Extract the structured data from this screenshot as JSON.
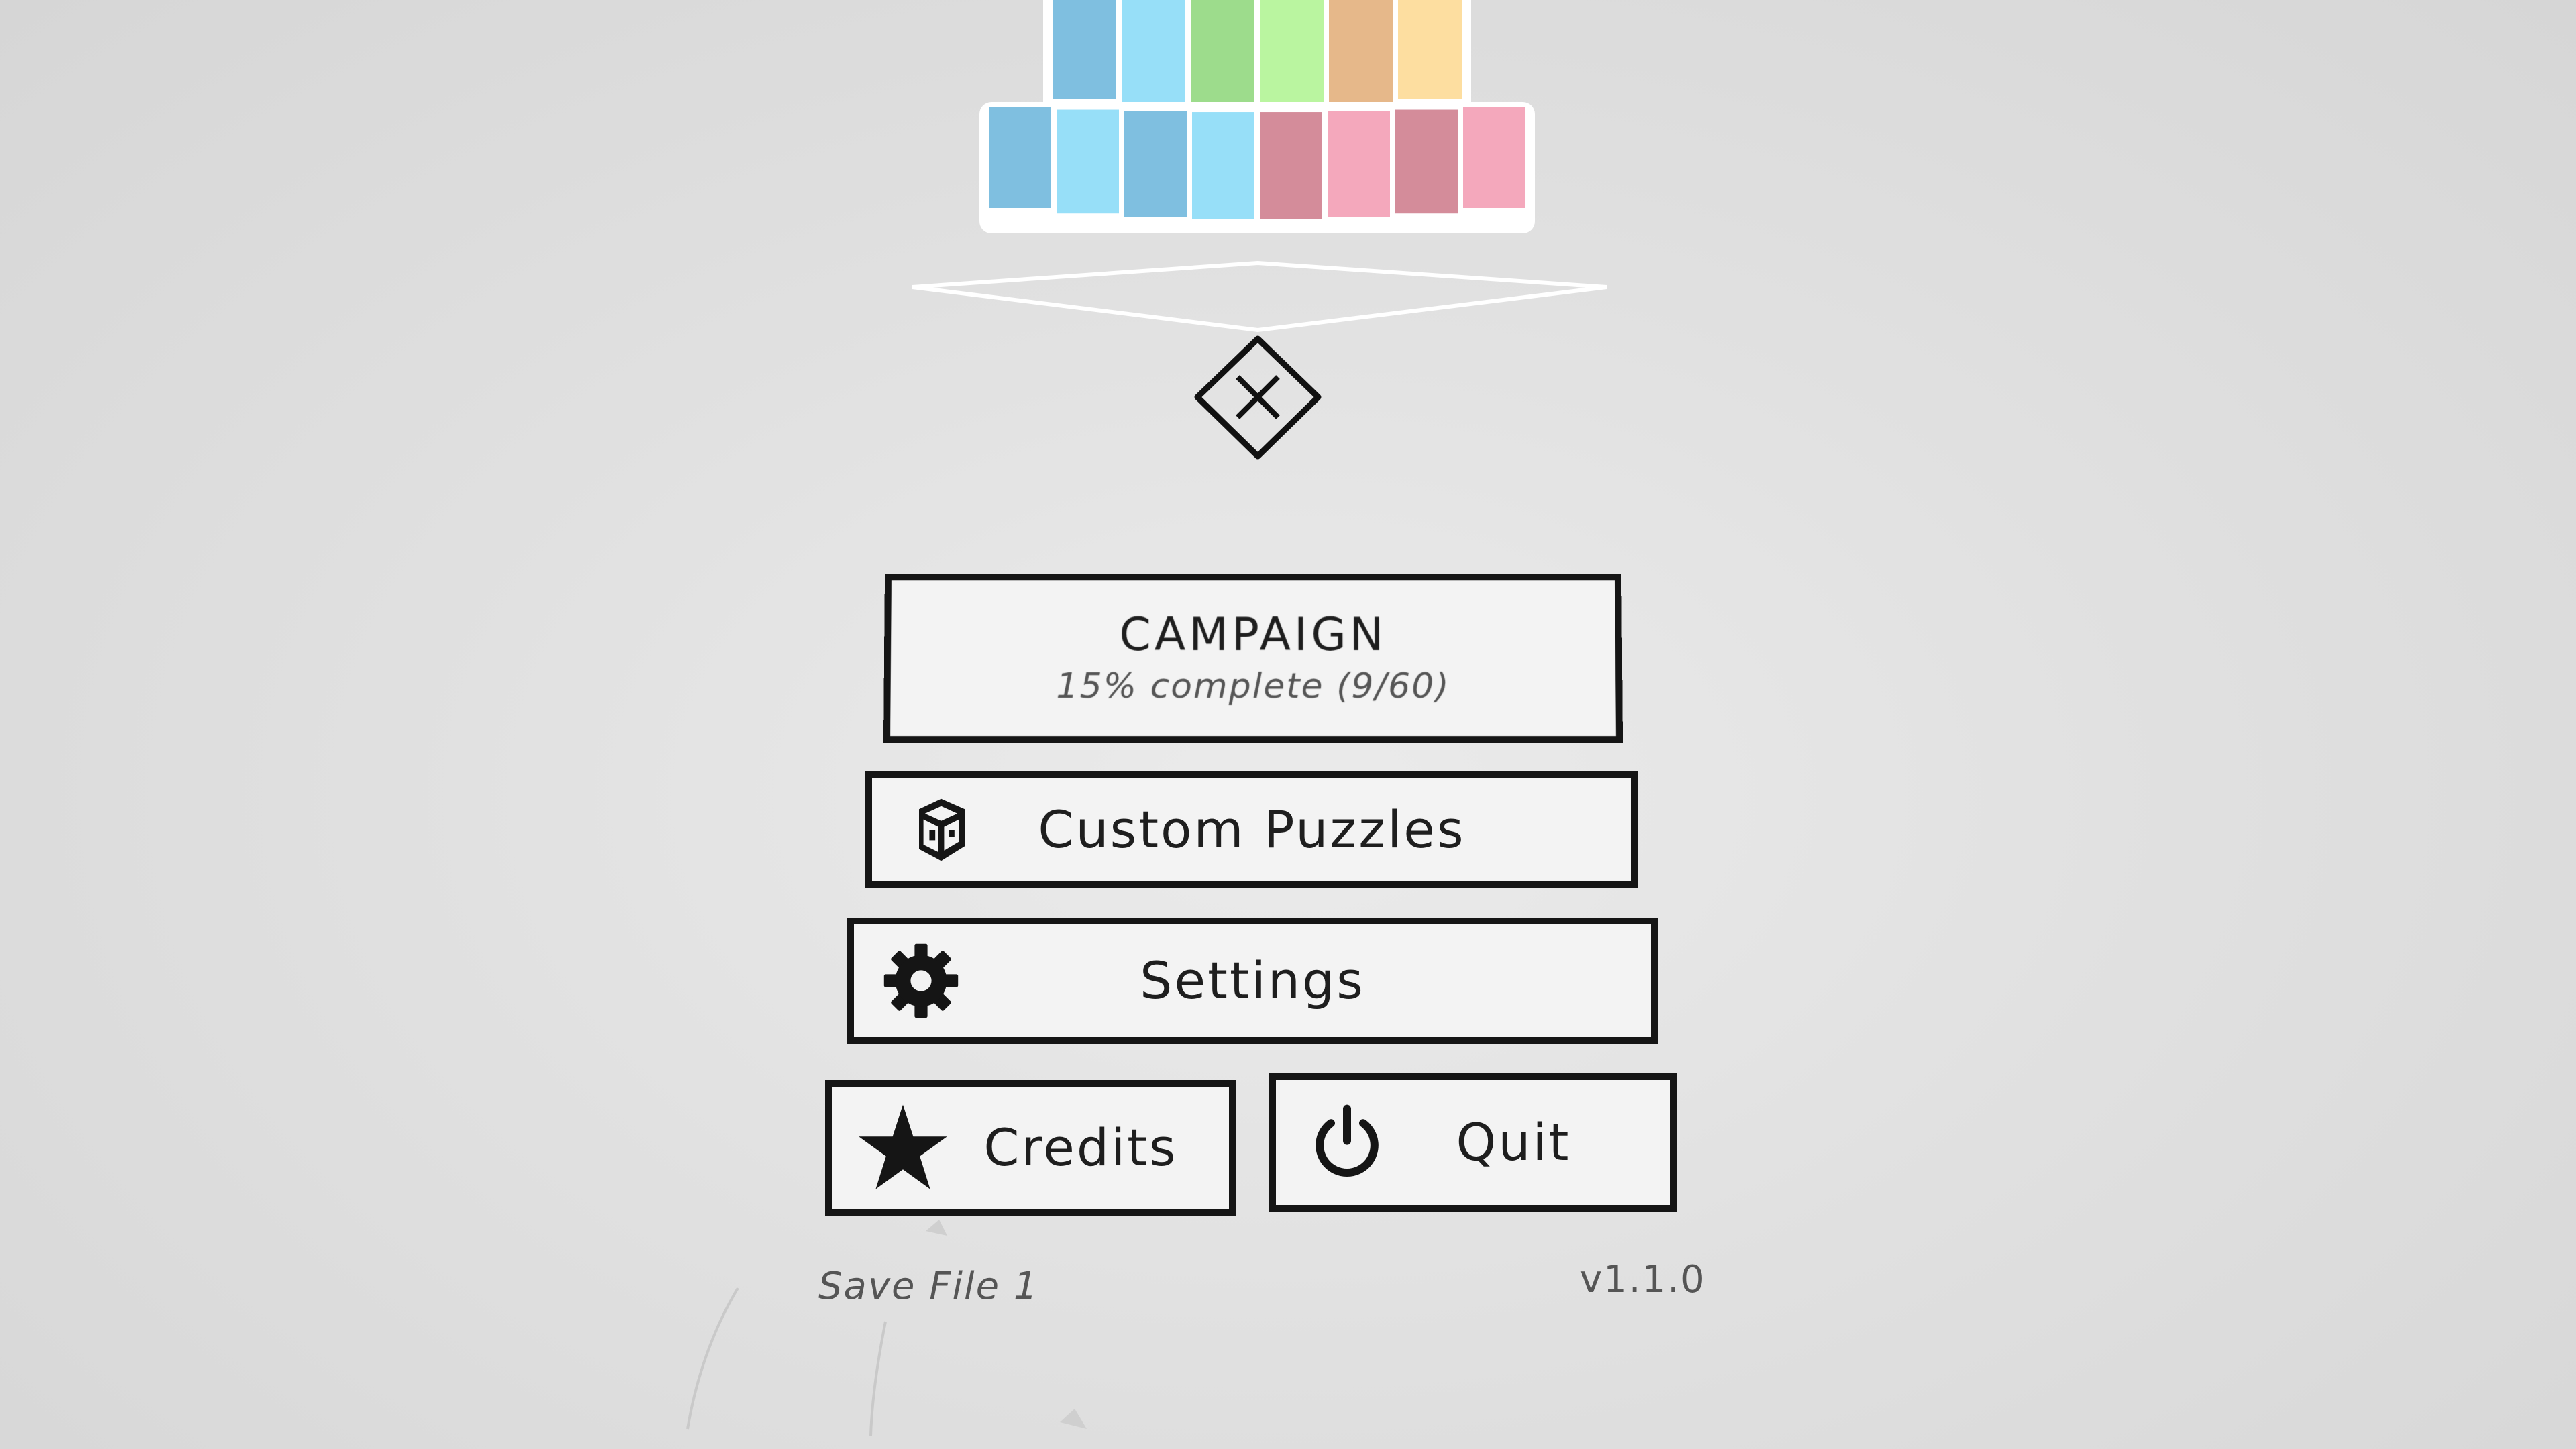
{
  "menu": {
    "campaign": {
      "title": "CAMPAIGN",
      "progress_text": "15% complete (9/60)",
      "progress_fraction": 0.15
    },
    "custom_puzzles": {
      "label": "Custom Puzzles",
      "icon": "cube-icon"
    },
    "settings": {
      "label": "Settings",
      "icon": "gear-icon"
    },
    "credits": {
      "label": "Credits",
      "icon": "star-icon"
    },
    "quit": {
      "label": "Quit",
      "icon": "power-icon"
    }
  },
  "footer": {
    "save_file": "Save File 1",
    "version": "v1.1.0"
  },
  "logo": {
    "top_row_colors": [
      "#7fbfe0",
      "#97dff8",
      "#9ddc8c",
      "#baf5a0",
      "#e6b88a",
      "#fddea0"
    ],
    "bottom_row_colors": [
      "#7fbfe0",
      "#97dff8",
      "#7fbfe0",
      "#97dff8",
      "#d48c9a",
      "#f4a8bc",
      "#d48c9a",
      "#f4a8bc"
    ],
    "close_icon": "close-icon"
  },
  "colors": {
    "background": "#e2e2e2",
    "button_fill": "#f3f3f3",
    "button_border": "#151515",
    "subtext": "#555555"
  }
}
